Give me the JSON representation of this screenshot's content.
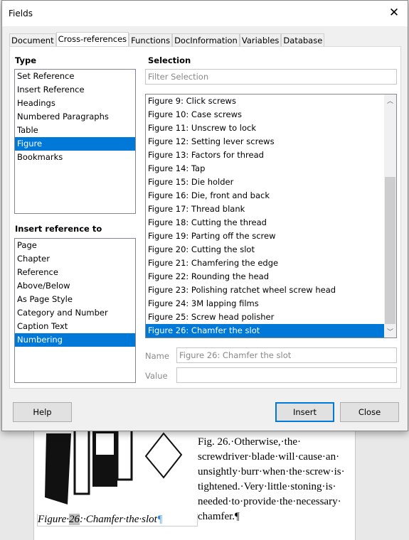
{
  "dialog": {
    "title": "Fields",
    "close_icon": "close-icon",
    "tabs": [
      {
        "label": "Document"
      },
      {
        "label": "Cross-references",
        "active": true
      },
      {
        "label": "Functions"
      },
      {
        "label": "DocInformation"
      },
      {
        "label": "Variables"
      },
      {
        "label": "Database"
      }
    ],
    "type_label": "Type",
    "type_items": [
      "Set Reference",
      "Insert Reference",
      "Headings",
      "Numbered Paragraphs",
      "Table",
      "Figure",
      "Bookmarks"
    ],
    "type_selected": "Figure",
    "insert_ref_label": "Insert reference to",
    "insert_ref_items": [
      "Page",
      "Chapter",
      "Reference",
      "Above/Below",
      "As Page Style",
      "Category and Number",
      "Caption Text",
      "Numbering"
    ],
    "insert_ref_selected": "Numbering",
    "selection_label": "Selection",
    "filter_placeholder": "Filter Selection",
    "selection_items": [
      "Figure 9: Click screws",
      "Figure 10: Case screws",
      "Figure 11: Unscrew to lock",
      "Figure 12: Setting lever screws",
      "Figure 13: Factors for thread",
      "Figure 14: Tap",
      "Figure 15: Die holder",
      "Figure 16: Die, front and back",
      "Figure 17: Thread blank",
      "Figure 18: Cutting the thread",
      "Figure 19: Parting off the screw",
      "Figure 20: Cutting the slot",
      "Figure 21: Chamfering the edge",
      "Figure 22: Rounding the head",
      "Figure 23: Polishing ratchet wheel screw head",
      "Figure 24: 3M lapping films",
      "Figure 25: Screw head polisher",
      "Figure 26: Chamfer the slot"
    ],
    "selection_selected": "Figure 26: Chamfer the slot",
    "name_label": "Name",
    "name_value": "Figure 26: Chamfer the slot",
    "value_label": "Value",
    "value_value": "",
    "help": "Help",
    "insert": "Insert",
    "close": "Close",
    "accent": "#0078d7"
  },
  "document": {
    "caption": {
      "prefix": "Figure·",
      "num": "26",
      "suffix": ":·Chamfer·the·slot",
      "pilcrow": "¶"
    },
    "lines": [
      "Fig. 26.·Otherwise,·the·",
      "screwdriver·blade·will·cause·an·",
      "unsightly·burr·when·the·screw·is·",
      "tightened.·Very·little·stoning·is·",
      "needed·to·provide·the·necessary·",
      "chamfer.¶"
    ]
  }
}
